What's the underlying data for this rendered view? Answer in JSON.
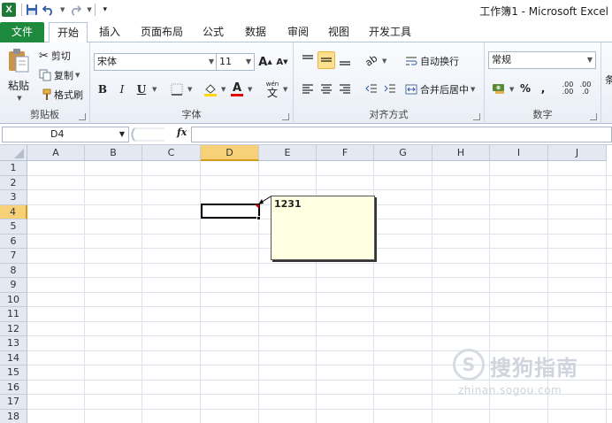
{
  "window": {
    "title": "工作簿1 - Microsoft Excel"
  },
  "qat": {
    "app_icon": "excel-icon"
  },
  "tabs": [
    {
      "label": "文件"
    },
    {
      "label": "开始"
    },
    {
      "label": "插入"
    },
    {
      "label": "页面布局"
    },
    {
      "label": "公式"
    },
    {
      "label": "数据"
    },
    {
      "label": "审阅"
    },
    {
      "label": "视图"
    },
    {
      "label": "开发工具"
    }
  ],
  "ribbon": {
    "clipboard": {
      "label": "剪贴板",
      "paste": "粘贴",
      "cut": "剪切",
      "copy": "复制",
      "format_painter": "格式刷"
    },
    "font": {
      "label": "字体",
      "font_name": "宋体",
      "font_size": "11",
      "bold": "B",
      "italic": "I",
      "underline": "U",
      "grow": "A",
      "shrink": "A",
      "font_color_letter": "A",
      "phonetic": "wén"
    },
    "alignment": {
      "label": "对齐方式",
      "wrap_text": "自动换行",
      "merge_center": "合并后居中"
    },
    "number": {
      "label": "数字",
      "format": "常规",
      "percent": "%",
      "comma": ",",
      "inc_decimal": ".00",
      "dec_decimal": ".0"
    },
    "styles": {
      "partial": "条"
    }
  },
  "formula_bar": {
    "name_box": "D4",
    "fx": "fx",
    "value": ""
  },
  "sheet": {
    "columns": [
      "A",
      "B",
      "C",
      "D",
      "E",
      "F",
      "G",
      "H",
      "I",
      "J"
    ],
    "rows": [
      "1",
      "2",
      "3",
      "4",
      "5",
      "6",
      "7",
      "8",
      "9",
      "10",
      "11",
      "12",
      "13",
      "14",
      "15",
      "16",
      "17",
      "18"
    ],
    "active_cell": "D4",
    "comment": {
      "text": "1231"
    }
  },
  "watermark": {
    "text": "搜狗指南",
    "url": "zhinan.sogou.com"
  },
  "colors": {
    "file_tab": "#1e8a3e",
    "header_highlight": "#f6d178",
    "comment_bg": "#ffffe1"
  }
}
